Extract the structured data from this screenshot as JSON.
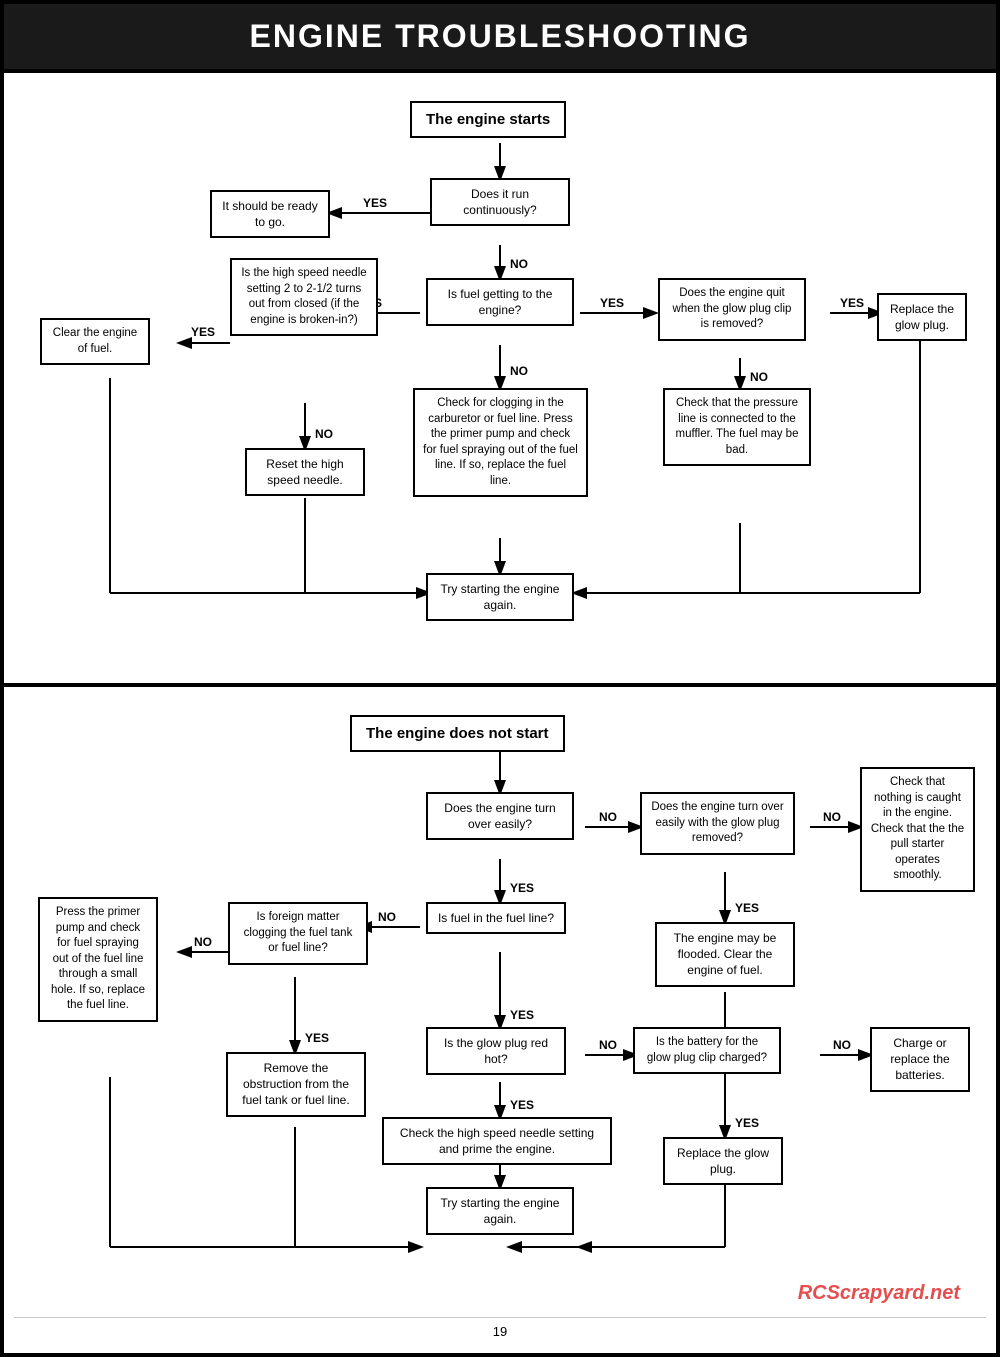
{
  "header": {
    "title": "ENGINE TROUBLESHOOTING"
  },
  "section1": {
    "title": "The engine starts",
    "boxes": {
      "engineStarts": "The engine starts",
      "doesItRun": "Does it run\ncontinuously?",
      "readyToGo": "It should be\nready to go.",
      "isHighSpeed": "Is the high\nspeed needle\nsetting 2 to\n2-1/2 turns out\nfrom closed (if\nthe engine is\nbroken-in?)",
      "clearEngine": "Clear the engine\nof fuel.",
      "resetHighSpeed": "Reset the high\nspeed needle.",
      "isFuelGetting": "Is fuel getting to\nthe engine?",
      "doesEngineQuit": "Does the engine\nquit when the\nglow plug clip is\nremoved?",
      "replaceGlowPlug": "Replace the\nglow plug.",
      "checkClogging": "Check for clogging in\nthe carburetor or fuel\nline. Press the\nprimer pump and\ncheck for fuel\nspraying out of the\nfuel line. If so,\nreplace the fuel line.",
      "checkPressure": "Check that the\npressure line is\nconnected to the\nmuffler. The fuel\nmay be bad.",
      "tryStarting1": "Try starting the\nengine again."
    },
    "labels": {
      "yes": "YES",
      "no": "NO"
    }
  },
  "section2": {
    "title": "The engine does not start",
    "boxes": {
      "engineNotStart": "The engine does not start",
      "doesEngTurnOver": "Does the engine\nturn over easily?",
      "doesEngTurnGlow": "Does the engine\nturn over easily\nwith the glow\nplug removed?",
      "checkNothing": "Check that\nnothing is\ncaught in the\nengine. Check\nthat the the\npull starter\noperates\nsmoothly.",
      "pressPrimer": "Press the\nprimer pump\nand check for\nfuel spraying\nout of the fuel\nline through a\nsmall hole. If\nso, replace\nthe fuel line.",
      "isForeignMatter": "Is foreign matter\nclogging the fuel\ntank or fuel line?",
      "isFuelInLine": "Is fuel in the\nfuel line?",
      "engineFlooded": "The engine may\nbe flooded.\nClear the engine\nof fuel.",
      "removeObstruction": "Remove the\nobstruction from\nthe fuel tank or\nfuel line.",
      "isGlowPlugRed": "Is the glow plug\nred hot?",
      "isBatteryCharged": "Is the battery for\nthe glow plug\nclip charged?",
      "chargeReplace": "Charge or\nreplace the\nbatteries.",
      "checkHighSpeed": "Check the high speed needle\nsetting and prime the engine.",
      "replaceGlowPlug2": "Replace the\nglow plug.",
      "tryStarting2": "Try starting the\nengine again."
    }
  },
  "footer": {
    "page": "19",
    "watermark": "RCScrapyard.net"
  }
}
